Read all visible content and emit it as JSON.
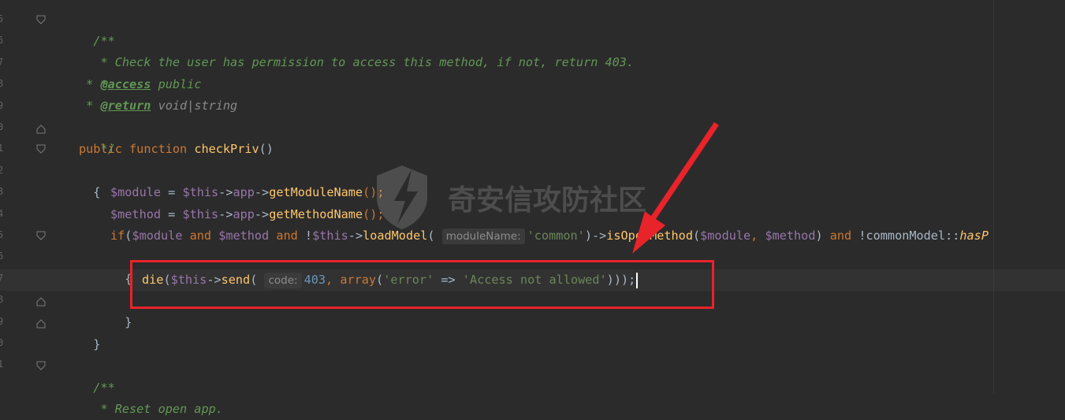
{
  "editor": {
    "line_numbers": [
      "5",
      "6",
      "7",
      "8",
      "9",
      "0",
      "1",
      "2",
      "3",
      "4",
      "5",
      "6",
      "7",
      "8",
      "9",
      "0",
      "1"
    ],
    "lines": {
      "l1": "/**",
      "l2": " * Check the user has permission to access this method, if not, return 403.",
      "l3": " *",
      "l4_pre": " * ",
      "l4_tag": "@access",
      "l4_post": " public",
      "l5_pre": " * ",
      "l5_tag": "@return",
      "l5_t1": " void",
      "l5_sep": "|",
      "l5_t2": "string",
      "l6": " */",
      "l7_kw1": "public",
      "l7_kw2": "function",
      "l7_fn": "checkPriv",
      "l7_paren": "()",
      "l8": "{",
      "l9_var": "$module",
      "l9_eq": " = ",
      "l9_this": "$this",
      "l9_arrow1": "->",
      "l9_app": "app",
      "l9_arrow2": "->",
      "l9_fn": "getModuleName",
      "l9_end": "();",
      "l10_var": "$method",
      "l10_eq": " = ",
      "l10_this": "$this",
      "l10_arrow1": "->",
      "l10_app": "app",
      "l10_arrow2": "->",
      "l10_fn": "getMethodName",
      "l10_end": "();",
      "l11_if": "if",
      "l11_p": "(",
      "l11_v1": "$module",
      "l11_and1": " and ",
      "l11_v2": "$method",
      "l11_and2": " and ",
      "l11_not": "!",
      "l11_this": "$this",
      "l11_arr": "->",
      "l11_fn": "loadModel",
      "l11_p2": "( ",
      "l11_hint": "moduleName:",
      "l11_str": "'common'",
      "l11_arr2": ")->",
      "l11_fn2": "isOpenMethod",
      "l11_p3": "(",
      "l11_v3": "$module",
      "l11_comma": ", ",
      "l11_v4": "$method",
      "l11_p4": ")",
      "l11_and3": " and ",
      "l11_not2": "!",
      "l11_cls": "commonModel",
      "l11_sc": "::",
      "l11_fn3": "hasP",
      "l12": "{",
      "l13_die": "die",
      "l13_p": "(",
      "l13_this": "$this",
      "l13_arr": "->",
      "l13_fn": "send",
      "l13_p2": "( ",
      "l13_hint": "code:",
      "l13_num": "403",
      "l13_comma": ", ",
      "l13_arr_kw": "array",
      "l13_p3": "(",
      "l13_s1": "'error'",
      "l13_fat": " => ",
      "l13_s2": "'Access not allowed'",
      "l13_end1": ")));",
      "l14": "}",
      "l15": "}",
      "l17": "/**",
      "l18": " * Reset open app."
    }
  },
  "watermark": {
    "text": "奇安信攻防社区"
  },
  "colors": {
    "background": "#2b2b2b",
    "highlight_box": "#e8232a",
    "doc_comment": "#629755",
    "keyword": "#cc7832",
    "function": "#ffc66d",
    "variable": "#9876aa",
    "string": "#6a8759",
    "number": "#6897bb"
  }
}
